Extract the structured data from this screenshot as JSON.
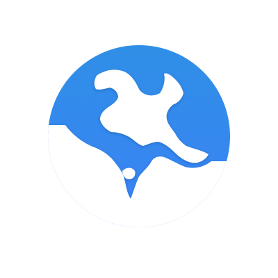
{
  "app_icon": {
    "icon": "globe-icon",
    "colors": {
      "background": "#ffffff",
      "globe_top": "#2f8fe6",
      "globe_bottom": "#3b82f6",
      "land": "#ffffff"
    }
  }
}
